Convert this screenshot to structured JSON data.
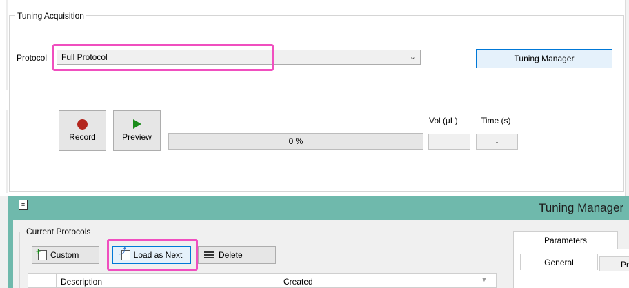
{
  "tuning_acquisition": {
    "group_title": "Tuning Acquisition",
    "protocol_label": "Protocol",
    "protocol_value": "Full Protocol",
    "protocol_dropdown_icon": "chevron-down-icon",
    "tuning_manager_button": "Tuning Manager",
    "record_button": "Record",
    "record_icon": "record-dot-icon",
    "preview_button": "Preview",
    "preview_icon": "play-icon",
    "progress_text": "0 %",
    "progress_value": 0,
    "vol_label": "Vol (µL)",
    "time_label": "Time (s)",
    "vol_value": "",
    "time_value": "-"
  },
  "tuning_manager": {
    "window_title": "Tuning Manager",
    "window_icon": "app-icon",
    "current_protocols_title": "Current Protocols",
    "toolbar": {
      "custom_label": "Custom",
      "load_next_label": "Load as Next",
      "delete_label": "Delete"
    },
    "table_columns": [
      "",
      "Description",
      "Created"
    ],
    "tabs": [
      "Parameters"
    ],
    "sub_tabs": [
      "General",
      "Pr"
    ]
  },
  "highlight_color": "#f04fbf",
  "window_header_color": "#6fb9ac"
}
